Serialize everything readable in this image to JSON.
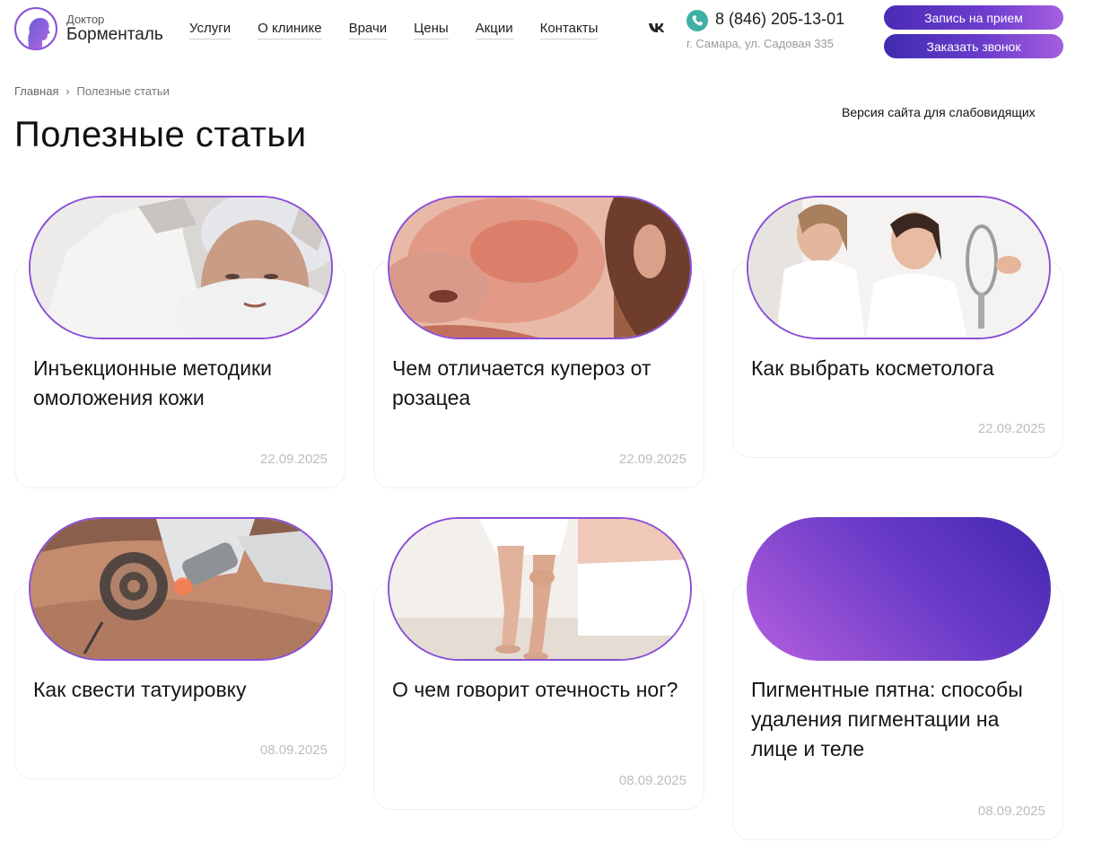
{
  "header": {
    "logo_small": "Доктор",
    "logo_big": "Борменталь",
    "nav": [
      {
        "label": "Услуги"
      },
      {
        "label": "О клинике"
      },
      {
        "label": "Врачи"
      },
      {
        "label": "Цены"
      },
      {
        "label": "Акции"
      },
      {
        "label": "Контакты"
      }
    ],
    "social_icon": "vk-icon",
    "phone": "8 (846) 205-13-01",
    "address": "г. Самара, ул. Садовая 335",
    "buttons": {
      "appointment": "Запись на прием",
      "callback": "Заказать звонок"
    }
  },
  "breadcrumb": {
    "home": "Главная",
    "separator": "›",
    "current": "Полезные статьи"
  },
  "accessibility_link": "Версия сайта для слабовидящих",
  "page_title": "Полезные статьи",
  "colors": {
    "accent_purple": "#8a4fd6",
    "button_start": "#4a2bb5",
    "button_end": "#a65fe0",
    "phone_green": "#3fb0a6",
    "date_gray": "#bdbdbd"
  },
  "articles": [
    {
      "title": "Инъекционные методики омоложения кожи",
      "date": "22.09.2025",
      "image": "injection-photo"
    },
    {
      "title": "Чем отличается купероз от розацеа",
      "date": "22.09.2025",
      "image": "couperose-photo"
    },
    {
      "title": "Как выбрать косметолога",
      "date": "22.09.2025",
      "image": "cosmetologist-photo"
    },
    {
      "title": "Как свести татуировку",
      "date": "08.09.2025",
      "image": "tattoo-removal-photo"
    },
    {
      "title": "О чем говорит отечность ног?",
      "date": "08.09.2025",
      "image": "leg-swelling-photo"
    },
    {
      "title": "Пигментные пятна: способы удаления пигментации на лице и теле",
      "date": "08.09.2025",
      "image": "gradient-placeholder"
    }
  ]
}
